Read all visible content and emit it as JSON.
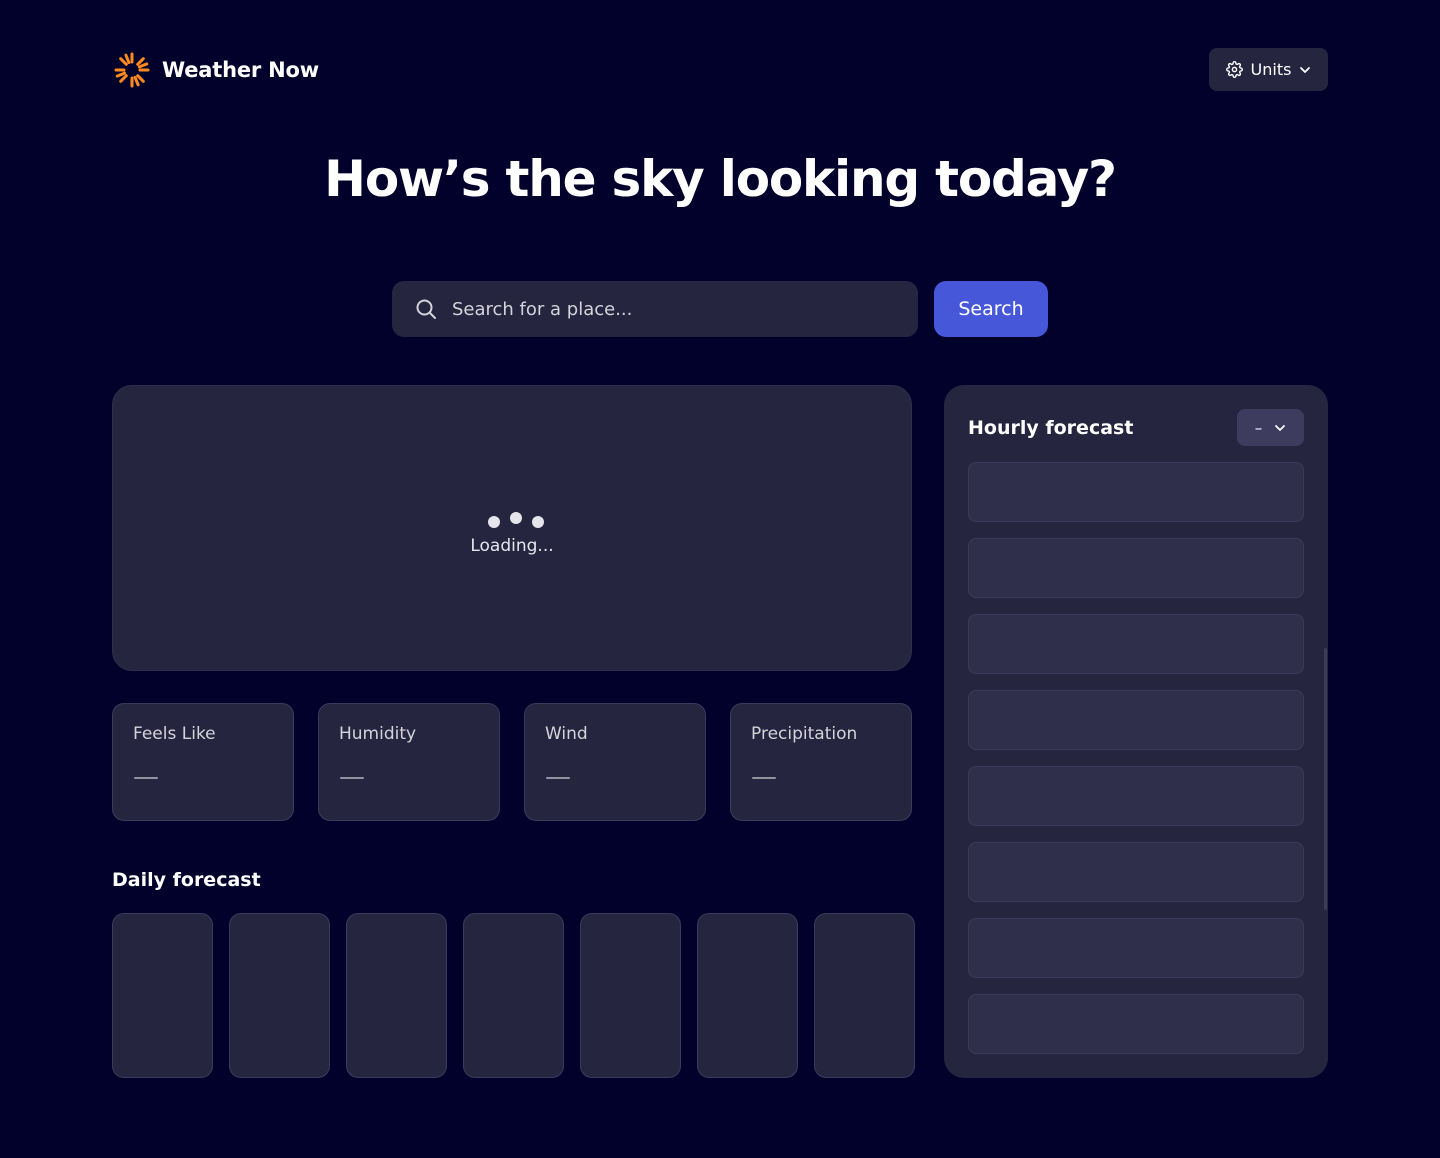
{
  "app": {
    "name": "Weather Now"
  },
  "header": {
    "units_label": "Units"
  },
  "hero": {
    "title": "How’s the sky looking today?"
  },
  "search": {
    "placeholder": "Search for a place...",
    "value": "",
    "button_label": "Search"
  },
  "current": {
    "loading_text": "Loading..."
  },
  "metrics": [
    {
      "label": "Feels Like",
      "value": "—"
    },
    {
      "label": "Humidity",
      "value": "—"
    },
    {
      "label": "Wind",
      "value": "—"
    },
    {
      "label": "Precipitation",
      "value": "—"
    }
  ],
  "daily": {
    "title": "Daily forecast"
  },
  "hourly": {
    "title": "Hourly forecast",
    "day_select_value": "–"
  },
  "colors": {
    "background": "#02012b",
    "surface": "#262540",
    "accent": "#4658d9",
    "logo": "#ff8a1f"
  }
}
